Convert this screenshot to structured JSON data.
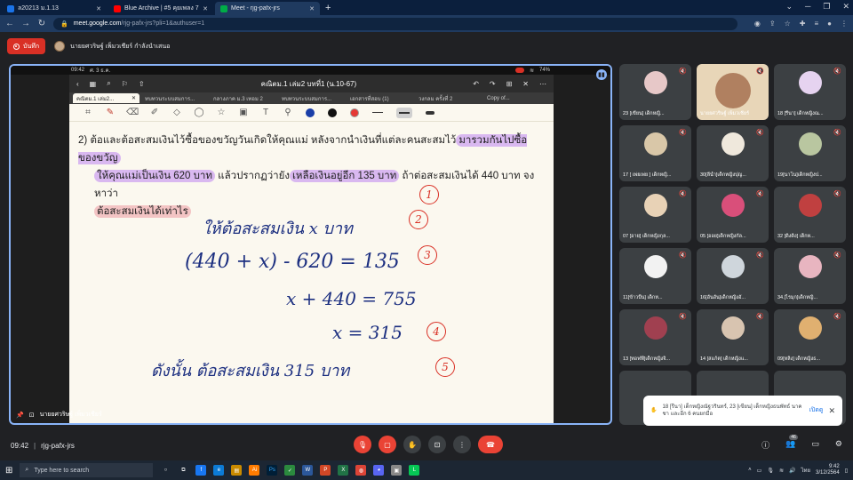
{
  "browser": {
    "tabs": [
      {
        "title": "ล20213 ม.1.13",
        "color": "#1a73e8"
      },
      {
        "title": "Blue Archive | #5 คุยเพลง 7 อัพโหลด",
        "color": "#ff0000"
      },
      {
        "title": "Meet - rjg-pafx-jrs",
        "color": "#00ac47"
      }
    ],
    "new_tab": "+",
    "url_host": "meet.google.com",
    "url_path": "/rjg-pafx-jrs?pli=1&authuser=1"
  },
  "meet": {
    "record_label": "บันทึก",
    "presenter_name": "นายยศวริษฐ์ เพ็มวเชียร์ กำลังนำเสนอ",
    "meeting_time": "09:42",
    "meeting_code": "rjg-pafx-jrs",
    "participants_count": "46",
    "stage_label": "นายยศวริษฐ์ เพ็มวเชียร์",
    "controls": {
      "mic": "mic-off",
      "cam": "cam-off",
      "hand": "raise-hand",
      "present": "present",
      "more": "more",
      "end": "end-call"
    }
  },
  "phone": {
    "time": "09:42",
    "date": "ศ. 3 ธ.ค.",
    "battery": "74%"
  },
  "app": {
    "title": "คณิตม.1 เล่ม2 บทที่1 (น.10-67)",
    "tabs": [
      "คณิตม.1 เล่ม2...",
      "ทบทวนระบบสมการ...",
      "กลางภาค ม.3 เทอม 2",
      "ทบทวนระบบสมการ...",
      "เอกสารที่สอบ (1)",
      "วงกลม ครั้งที่ 2",
      "Copy of..."
    ]
  },
  "problem": {
    "number": "2)",
    "line1_a": "ต้อและต้อสะสมเงินไว้ซื้อของขวัญวันเกิดให้คุณแม่  หลังจากนำเงินที่แต่ละคนสะสมไว้",
    "line1_hl": "มารวมกันไปซื้อของขวัญ",
    "line2_hl1": "ให้คุณแม่เป็นเงิน 620 บาท",
    "line2_b": " แล้วปรากฏว่ายัง",
    "line2_hl2": "เหลือเงินอยู่อีก 135 บาท",
    "line2_c": " ถ้าต่อสะสมเงินได้ 440 บาท  จงหาว่า",
    "line3_hl": "ต้อสะสมเงินได้เท่าไร"
  },
  "handwriting": {
    "step1": "ให้ต้อสะสมเงิน   x  บาท",
    "step2": "(440 + x)  -  620  =  135",
    "step3": "x + 440  =  755",
    "step4": "x  =  315",
    "step5": "ดังนั้น   ต้อสะสมเงิน   315   บาท",
    "marks": [
      "1",
      "2",
      "3",
      "4",
      "5"
    ]
  },
  "participants": [
    {
      "label": "23 [เขียน] เด็กหญิ...",
      "face": "#e7c8c8"
    },
    {
      "label": "นายยศวริษฐ์ เพ็มวเชียร์",
      "face": "#b08060",
      "video": true
    },
    {
      "label": "18 [รีนา] เด็กหญิงณ...",
      "face": "#e6d3f0"
    },
    {
      "label": "17 [ เพ่ยเพ่ย ] เด็กหญิ...",
      "face": "#d9c7a8"
    },
    {
      "label": "30[ลีน้ำ]เด็กหญิงปุญ...",
      "face": "#efe8dc"
    },
    {
      "label": "19[นาโน]เด็กหญิงป...",
      "face": "#b9c6a0"
    },
    {
      "label": "07 [อาย] เด็กหญิงกุล...",
      "face": "#e8d2b6"
    },
    {
      "label": "05 [ออย]เด็กหญิงกัล...",
      "face": "#d94f7a"
    },
    {
      "label": "32 [ดิงดิง] เด็กห...",
      "face": "#c04040"
    },
    {
      "label": "11[ข้าวปั้น] เด็กห...",
      "face": "#f2f2f2"
    },
    {
      "label": "16[อันอัน]เด็กหญิงอั...",
      "face": "#cfd6dc"
    },
    {
      "label": "34.[ไรมุก]เด็กหญิ...",
      "face": "#e8b5c0"
    },
    {
      "label": "13 [ทอฟฟี่]เด็กหญิงจิ...",
      "face": "#a04050"
    },
    {
      "label": "14 [สแก้ต] เด็กหญิงแ...",
      "face": "#d8c4b0"
    },
    {
      "label": "09[หลิง] เด็กหญิงธ...",
      "face": "#e0b070"
    }
  ],
  "toast": {
    "message": "18 [รีนา] เด็กหญิงณัฐวรินทร์, 23 [เขียน] เด็กหญิงธนพัทธ์ นาคชา และอีก 6 คนยกมือ",
    "action": "เปิดดู"
  },
  "taskbar": {
    "search_placeholder": "Type here to search",
    "time": "9:42",
    "date": "3/12/2564",
    "lang": "ไทย"
  },
  "colors": {
    "accent_blue": "#8ab4f8",
    "end_call_red": "#ea4335",
    "highlight_purple": "#d9b8f0",
    "highlight_pink": "#f3c4c4",
    "ink_blue": "#1c2f80",
    "ink_red": "#d93025"
  }
}
